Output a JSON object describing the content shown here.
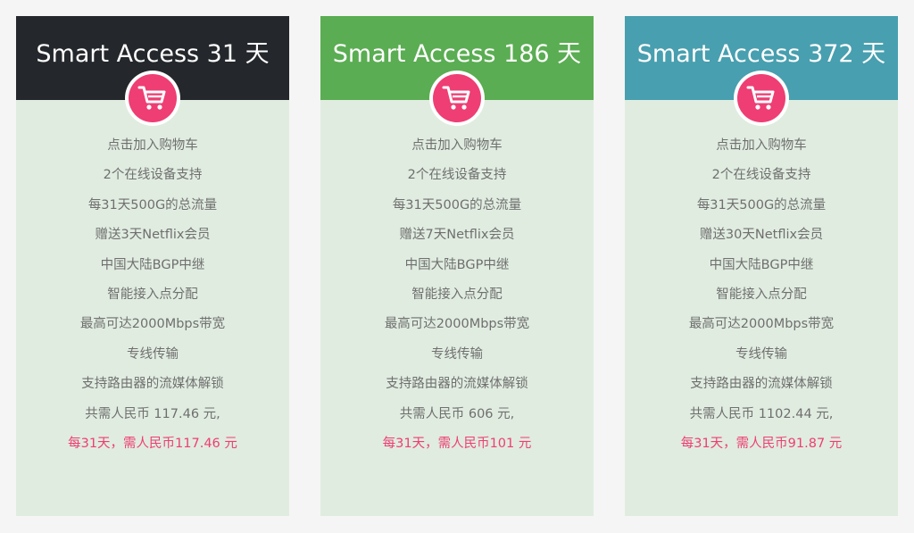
{
  "colors": {
    "card_body": "#e0ece0",
    "cart_badge": "#ee3e73",
    "highlight_text": "#ee3e73",
    "page_background": "#f5f5f5"
  },
  "plans": [
    {
      "title": "Smart Access 31 天",
      "header_color": "#24272b",
      "icon": "shopping-cart-icon",
      "features": [
        "点击加入购物车",
        "2个在线设备支持",
        "每31天500G的总流量",
        "赠送3天Netflix会员",
        "中国大陆BGP中继",
        "智能接入点分配",
        "最高可达2000Mbps带宽",
        "专线传输",
        "支持路由器的流媒体解锁",
        "共需人民币 117.46 元,"
      ],
      "monthly_price": "每31天，需人民币117.46 元"
    },
    {
      "title": "Smart Access 186 天",
      "header_color": "#5aad52",
      "icon": "shopping-cart-icon",
      "features": [
        "点击加入购物车",
        "2个在线设备支持",
        "每31天500G的总流量",
        "赠送7天Netflix会员",
        "中国大陆BGP中继",
        "智能接入点分配",
        "最高可达2000Mbps带宽",
        "专线传输",
        "支持路由器的流媒体解锁",
        "共需人民币 606 元,"
      ],
      "monthly_price": "每31天，需人民币101 元"
    },
    {
      "title": "Smart Access 372 天",
      "header_color": "#489faf",
      "icon": "shopping-cart-icon",
      "features": [
        "点击加入购物车",
        "2个在线设备支持",
        "每31天500G的总流量",
        "赠送30天Netflix会员",
        "中国大陆BGP中继",
        "智能接入点分配",
        "最高可达2000Mbps带宽",
        "专线传输",
        "支持路由器的流媒体解锁",
        "共需人民币 1102.44 元,"
      ],
      "monthly_price": "每31天，需人民币91.87 元"
    }
  ]
}
